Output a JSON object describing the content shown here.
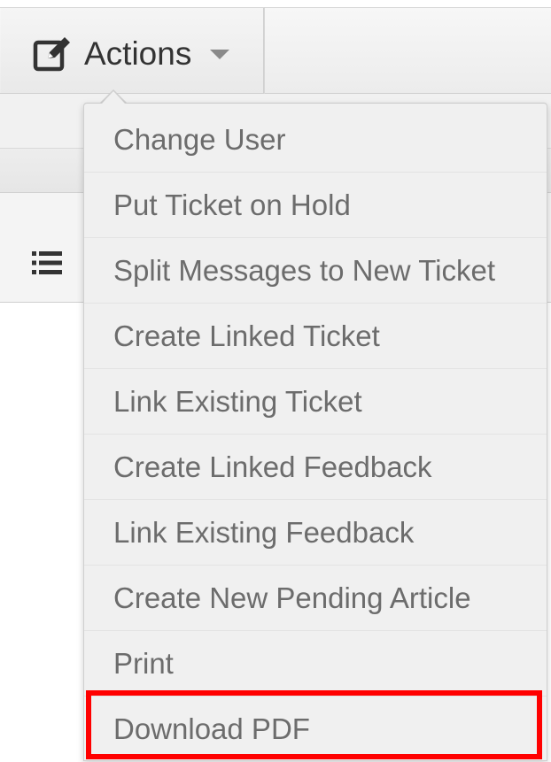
{
  "toolbar": {
    "actions_label": "Actions",
    "actions_icon": "edit-icon",
    "caret_icon": "caret-down-icon"
  },
  "background": {
    "list_icon": "list-icon"
  },
  "menu": {
    "items": [
      {
        "label": "Change User"
      },
      {
        "label": "Put Ticket on Hold"
      },
      {
        "label": "Split Messages to New Ticket"
      },
      {
        "label": "Create Linked Ticket"
      },
      {
        "label": "Link Existing Ticket"
      },
      {
        "label": "Create Linked Feedback"
      },
      {
        "label": "Link Existing Feedback"
      },
      {
        "label": "Create New Pending Article"
      },
      {
        "label": "Print"
      },
      {
        "label": "Download PDF"
      }
    ],
    "highlighted_item": "Download PDF",
    "highlight_color": "#ff0000"
  }
}
